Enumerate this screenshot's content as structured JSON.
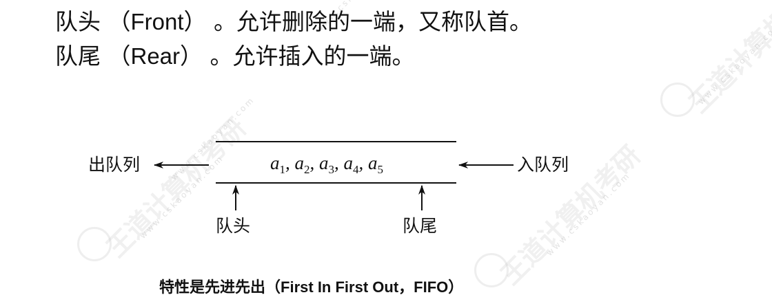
{
  "definitions": [
    {
      "term": "队头",
      "en": "Front",
      "desc": "。允许删除的一端，又称队首。"
    },
    {
      "term": "队尾",
      "en": "Rear",
      "desc": "。允许插入的一端。"
    }
  ],
  "diagram": {
    "dequeue_label": "出队列",
    "enqueue_label": "入队列",
    "front_label": "队头",
    "rear_label": "队尾",
    "elements": [
      {
        "var": "a",
        "sub": "1"
      },
      {
        "var": "a",
        "sub": "2"
      },
      {
        "var": "a",
        "sub": "3"
      },
      {
        "var": "a",
        "sub": "4"
      },
      {
        "var": "a",
        "sub": "5"
      }
    ]
  },
  "footer": {
    "cn": "特性是先进先出",
    "en_full": "First In First Out",
    "en_abbr": "FIFO"
  },
  "watermark": {
    "brand": "王道计算机考研",
    "site": "www.cskaoyan.com"
  }
}
